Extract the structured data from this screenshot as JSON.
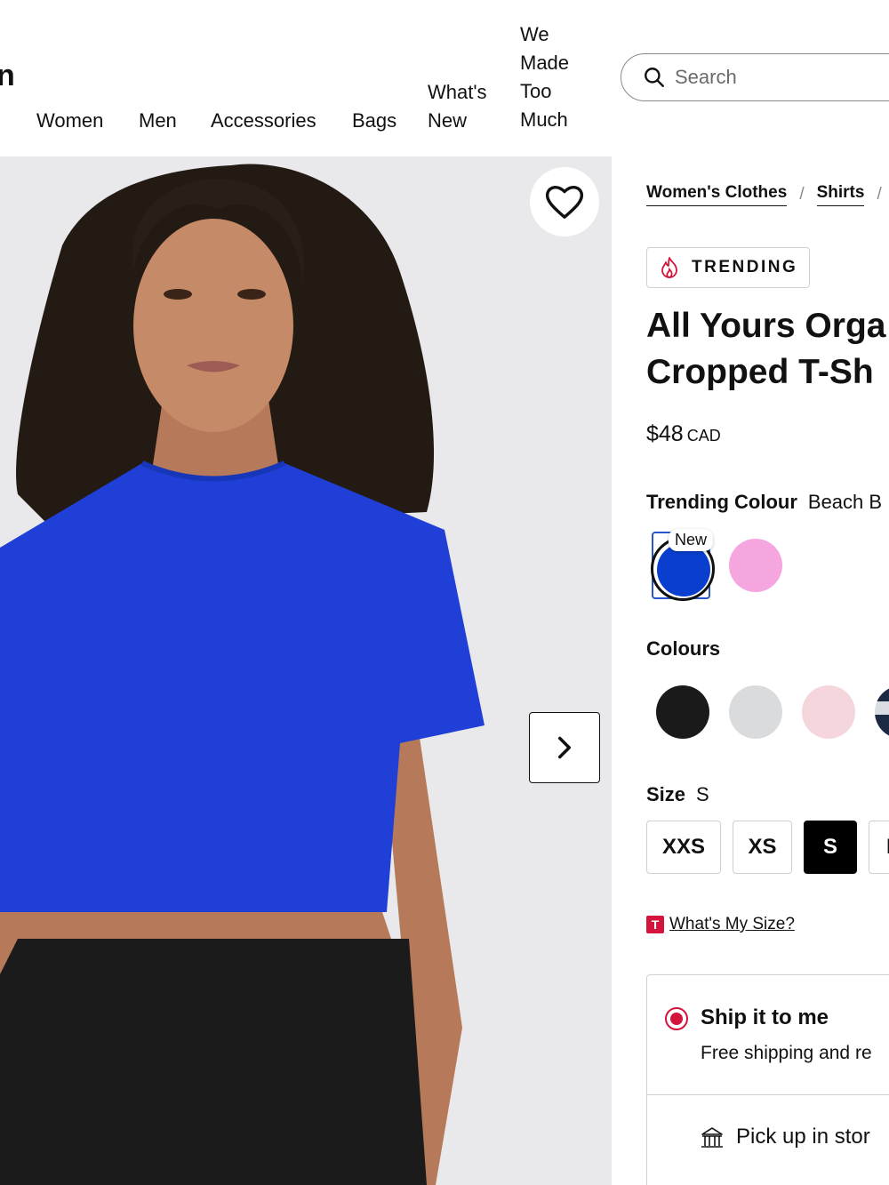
{
  "header": {
    "logo_fragment": "n",
    "nav": {
      "women": "Women",
      "men": "Men",
      "accessories": "Accessories",
      "bags": "Bags",
      "whats_new_line1": "What's",
      "whats_new_line2": "New",
      "wmtm_line1": "We",
      "wmtm_line2": "Made",
      "wmtm_line3": "Too",
      "wmtm_line4": "Much"
    },
    "search": {
      "placeholder": "Search",
      "icon": "search-icon"
    }
  },
  "gallery": {
    "favourite_icon": "heart-icon",
    "next_icon": "chevron-right-icon"
  },
  "product": {
    "breadcrumbs": [
      "Women's Clothes",
      "Shirts"
    ],
    "breadcrumb_separator": "/",
    "badge": {
      "icon": "flame-icon",
      "label": "TRENDING"
    },
    "title_line1": "All Yours Orga",
    "title_line2": "Cropped T-Sh",
    "price": "$48",
    "currency": "CAD",
    "trending_colour": {
      "label": "Trending Colour",
      "value": "Beach B"
    },
    "trending_swatches": [
      {
        "color": "#0a3ecf",
        "selected": true,
        "tag": "New"
      },
      {
        "color": "#f6a6de",
        "selected": false
      }
    ],
    "colours_label": "Colours",
    "colour_swatches": [
      "#1a1a1a",
      "#dadbdd",
      "#f4d6dc",
      "striped navy"
    ],
    "size": {
      "label": "Size",
      "selected": "S",
      "options": [
        "XXS",
        "XS",
        "S",
        "M"
      ]
    },
    "whats_my_size": {
      "logo": "T",
      "label": "What's My Size?"
    },
    "fulfillment": {
      "ship": {
        "title": "Ship it to me",
        "subtitle": "Free shipping and re",
        "selected": true
      },
      "pickup": {
        "title": "Pick up in stor",
        "icon": "store-icon"
      }
    }
  },
  "colors": {
    "accent_red": "#d3143c",
    "select_blue": "#2b56c8",
    "shirt_blue": "#1f3fd6"
  }
}
